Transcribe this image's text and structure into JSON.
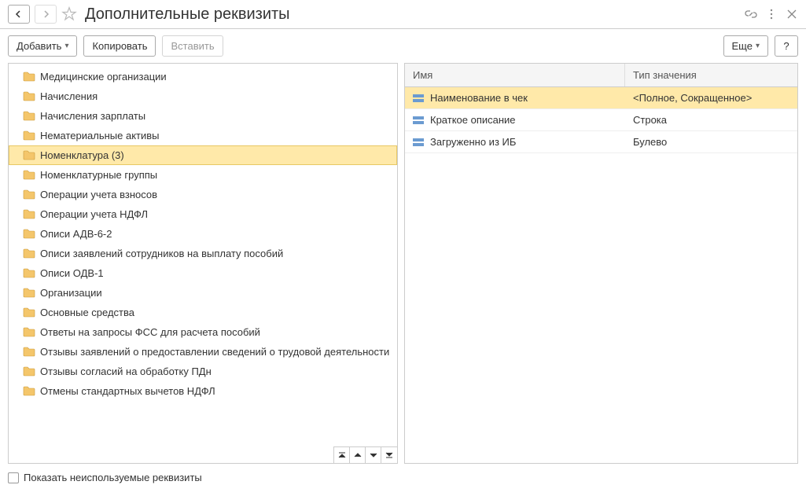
{
  "header": {
    "title": "Дополнительные реквизиты"
  },
  "toolbar": {
    "add": "Добавить",
    "copy": "Копировать",
    "paste": "Вставить",
    "more": "Еще",
    "help": "?"
  },
  "tree": {
    "items": [
      {
        "label": "Медицинские организации",
        "selected": false
      },
      {
        "label": "Начисления",
        "selected": false
      },
      {
        "label": "Начисления зарплаты",
        "selected": false
      },
      {
        "label": "Нематериальные активы",
        "selected": false
      },
      {
        "label": "Номенклатура (3)",
        "selected": true
      },
      {
        "label": "Номенклатурные группы",
        "selected": false
      },
      {
        "label": "Операции учета взносов",
        "selected": false
      },
      {
        "label": "Операции учета НДФЛ",
        "selected": false
      },
      {
        "label": "Описи АДВ-6-2",
        "selected": false
      },
      {
        "label": "Описи заявлений сотрудников на выплату пособий",
        "selected": false
      },
      {
        "label": "Описи ОДВ-1",
        "selected": false
      },
      {
        "label": "Организации",
        "selected": false
      },
      {
        "label": "Основные средства",
        "selected": false
      },
      {
        "label": "Ответы на запросы ФСС для расчета пособий",
        "selected": false
      },
      {
        "label": "Отзывы заявлений о предоставлении сведений о трудовой деятельности",
        "selected": false
      },
      {
        "label": "Отзывы согласий на обработку ПДн",
        "selected": false
      },
      {
        "label": "Отмены стандартных вычетов НДФЛ",
        "selected": false
      }
    ]
  },
  "table": {
    "headers": {
      "name": "Имя",
      "type": "Тип значения"
    },
    "rows": [
      {
        "name": "Наименование в чек",
        "type": "<Полное, Сокращенное>",
        "selected": true
      },
      {
        "name": "Краткое описание",
        "type": "Строка",
        "selected": false
      },
      {
        "name": "Загруженно из ИБ",
        "type": "Булево",
        "selected": false
      }
    ]
  },
  "footer": {
    "checkbox_label": "Показать неиспользуемые реквизиты"
  }
}
